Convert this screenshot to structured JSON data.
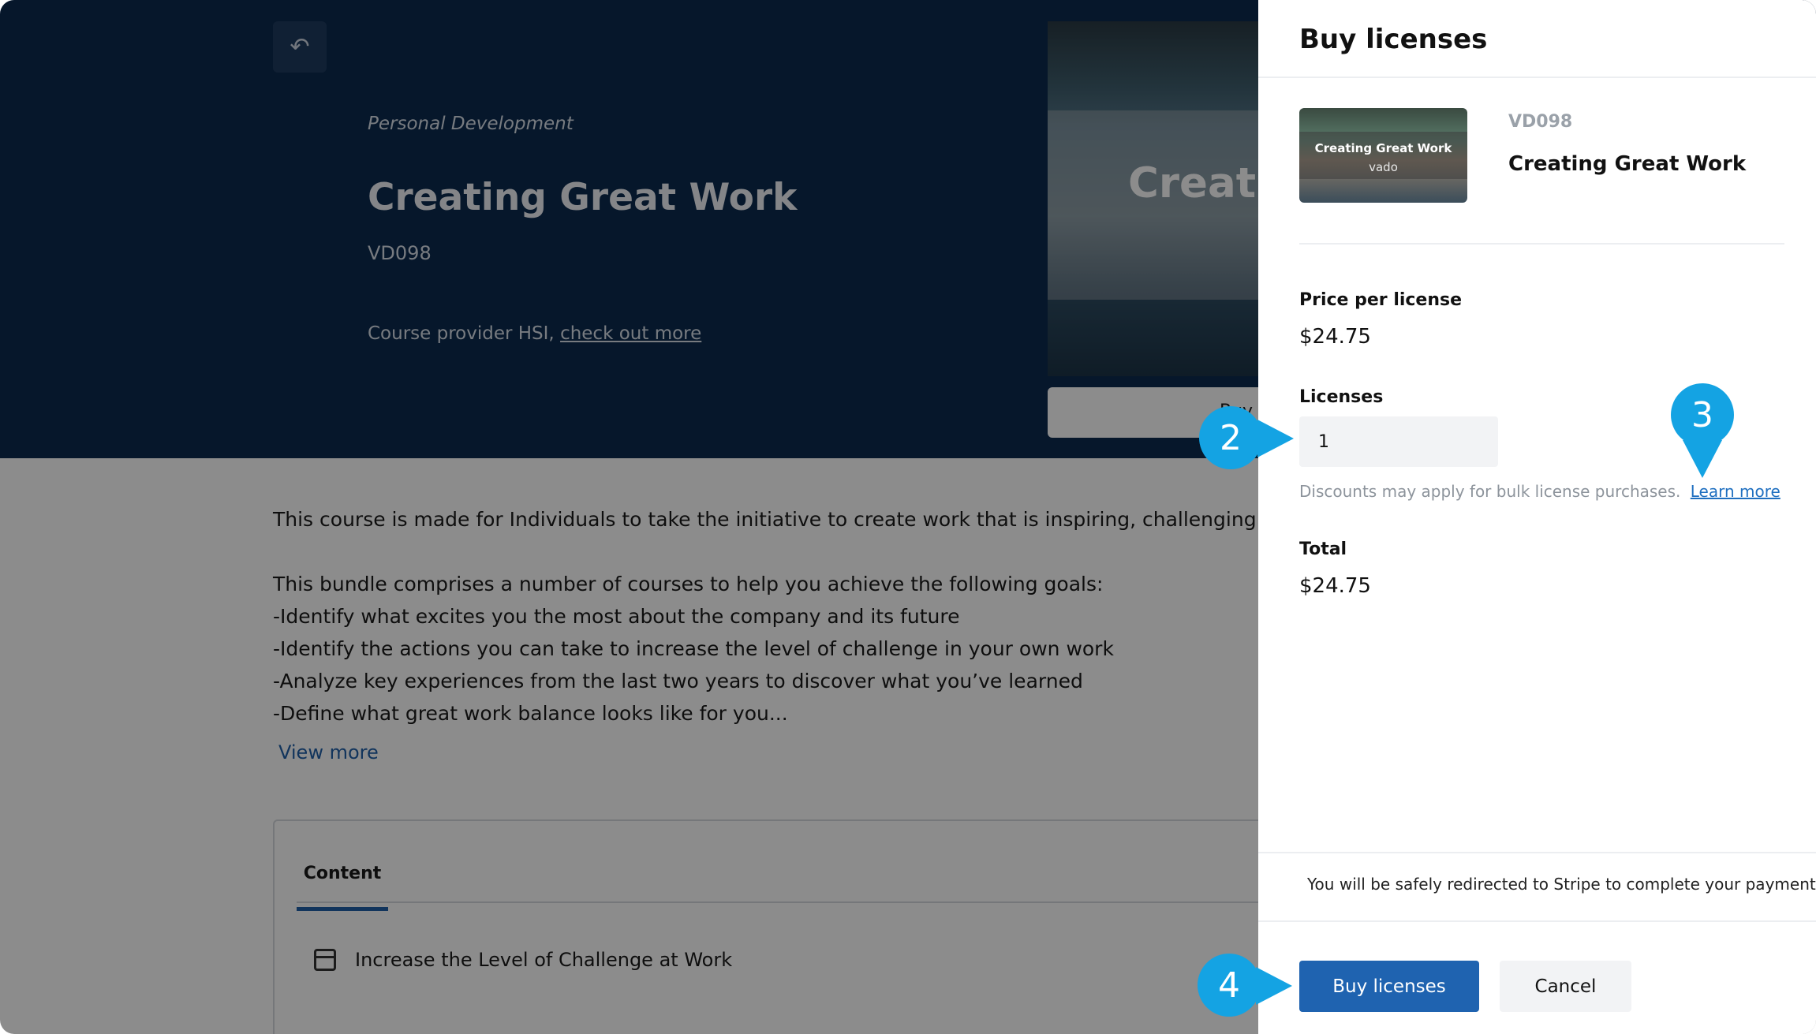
{
  "background_page": {
    "back_icon": "logout-arrow-icon",
    "category": "Personal Development",
    "course_title": "Creating Great Work",
    "course_code": "VD098",
    "provider_prefix": "Course provider HSI,",
    "provider_link": "check out more",
    "thumbnail_text": "Creating",
    "buy_button_partial": "Buy",
    "description": [
      "This course is made for Individuals to take the initiative to create work that is inspiring, challenging and f",
      "",
      "This bundle comprises a number of courses to help you achieve the following goals:",
      "-Identify what excites you the most about the company and its future",
      "-Identify the actions you can take to increase the level of challenge in your own work",
      "-Analyze key experiences from the last two years to discover what you’ve learned",
      "-Define what great work balance looks like for you..."
    ],
    "view_more": "View more",
    "tab_content": "Content",
    "lesson_icon": "calendar-icon",
    "lesson_title": "Increase the Level of Challenge at Work"
  },
  "drawer": {
    "title": "Buy licenses",
    "item_thumbnail_title": "Creating Great Work",
    "item_thumbnail_sub": "vado",
    "item_code": "VD098",
    "item_title": "Creating Great Work",
    "price_label": "Price per license",
    "price_value": "$24.75",
    "licenses_label": "Licenses",
    "licenses_value": "1",
    "discount_note": "Discounts may apply for bulk license purchases.",
    "learn_more": "Learn more",
    "total_label": "Total",
    "total_value": "$24.75",
    "stripe_note": "You will be safely redirected to Stripe to complete your payment",
    "buy_button": "Buy licenses",
    "cancel_button": "Cancel"
  },
  "markers": {
    "m2": "2",
    "m3": "3",
    "m4": "4"
  },
  "colors": {
    "hero_bg": "#0b2a4f",
    "primary": "#1f63b0",
    "marker": "#14a3e3"
  }
}
